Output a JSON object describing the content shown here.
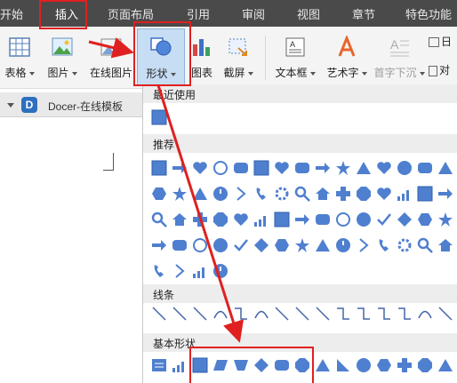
{
  "menu": {
    "items": [
      "开始",
      "插入",
      "页面布局",
      "引用",
      "审阅",
      "视图",
      "章节",
      "特色功能"
    ],
    "active_index": 1
  },
  "ribbon": {
    "table_label": "表格",
    "picture_label": "图片",
    "online_picture_label": "在线图片",
    "shape_label": "形状",
    "chart_label": "图表",
    "screenshot_label": "截屏",
    "textbox_label": "文本框",
    "wordart_label": "艺术字",
    "dropcap_label": "首字下沉",
    "date_label": "日",
    "object_label": "对"
  },
  "doc_tab": {
    "label": "Docer-在线模板"
  },
  "panel": {
    "recent_heading": "最近使用",
    "recommended_heading": "推荐",
    "lines_heading": "线条",
    "basic_heading": "基本形状"
  },
  "colors": {
    "menubar_bg": "#4a4a4a",
    "shape_blue": "#4f7fcf",
    "annotation_red": "#e02020"
  }
}
